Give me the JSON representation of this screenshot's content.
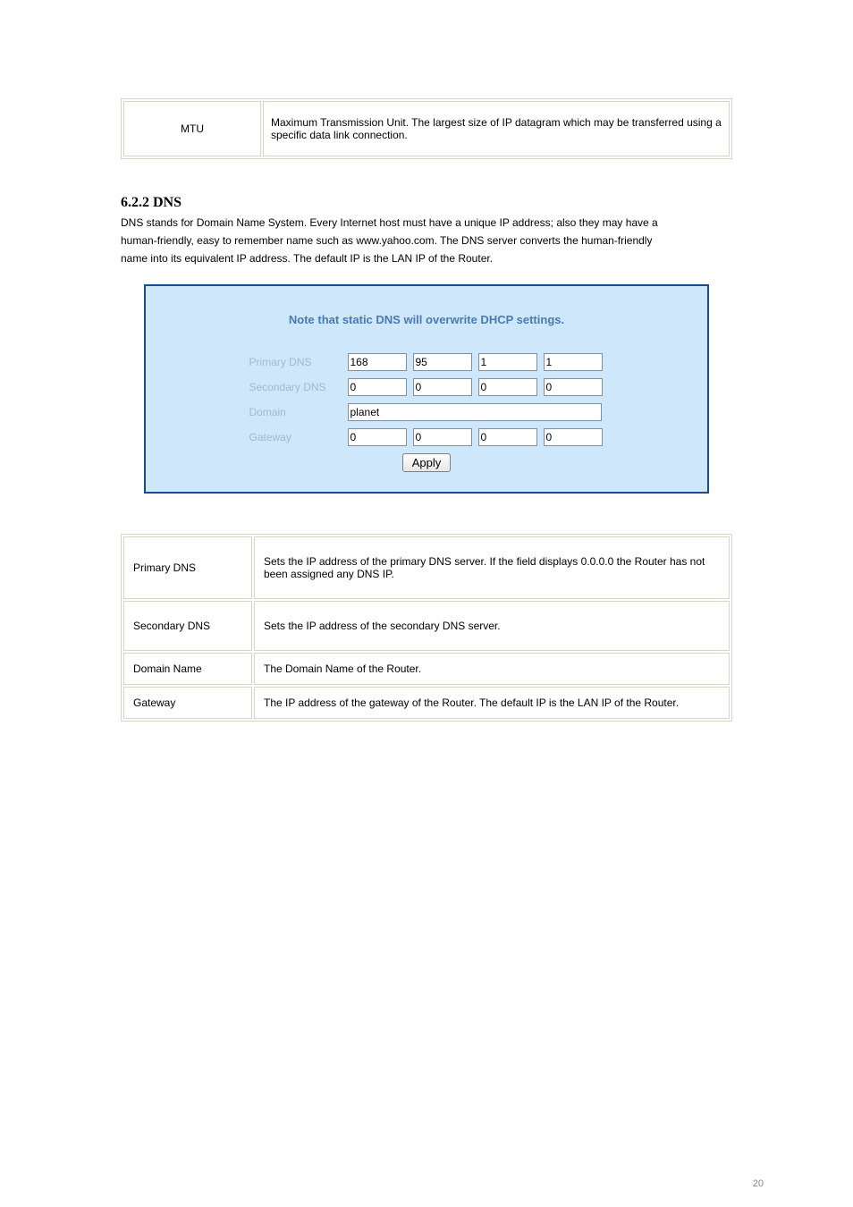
{
  "top_table": {
    "r0c0": "MTU",
    "r0c1": "Maximum Transmission Unit. The largest size of IP datagram which may be transferred using a specific data link connection."
  },
  "section": {
    "number": "6.2.2",
    "title": "DNS",
    "desc": "DNS stands for Domain Name System. Every Internet host must have a unique IP address; also they may have a",
    "desc2": "human-friendly, easy to remember name such as www.yahoo.com. The DNS server converts the human-friendly",
    "desc3": "name into its equivalent IP address. The default IP is the LAN IP of the Router."
  },
  "dns_panel": {
    "note": "Note that static DNS will overwrite DHCP settings.",
    "labels": {
      "primary": "Primary DNS",
      "secondary": "Secondary DNS",
      "domain": "Domain",
      "gateway": "Gateway"
    },
    "values": {
      "primary": [
        "168",
        "95",
        "1",
        "1"
      ],
      "secondary": [
        "0",
        "0",
        "0",
        "0"
      ],
      "domain": "planet",
      "gateway": [
        "0",
        "0",
        "0",
        "0"
      ]
    },
    "apply": "Apply"
  },
  "desc_table": {
    "rows": [
      {
        "label": "Primary DNS",
        "text": "Sets the IP address of the primary DNS server. If the field displays 0.0.0.0 the Router has not been assigned any DNS IP."
      },
      {
        "label": "Secondary DNS",
        "text": "Sets the IP address of the secondary DNS server."
      },
      {
        "label": "Domain Name",
        "text": "The Domain Name of the Router."
      },
      {
        "label": "Gateway",
        "text": "The IP address of the gateway of the Router. The default IP is the LAN IP of the Router."
      }
    ]
  },
  "page_number": "20"
}
